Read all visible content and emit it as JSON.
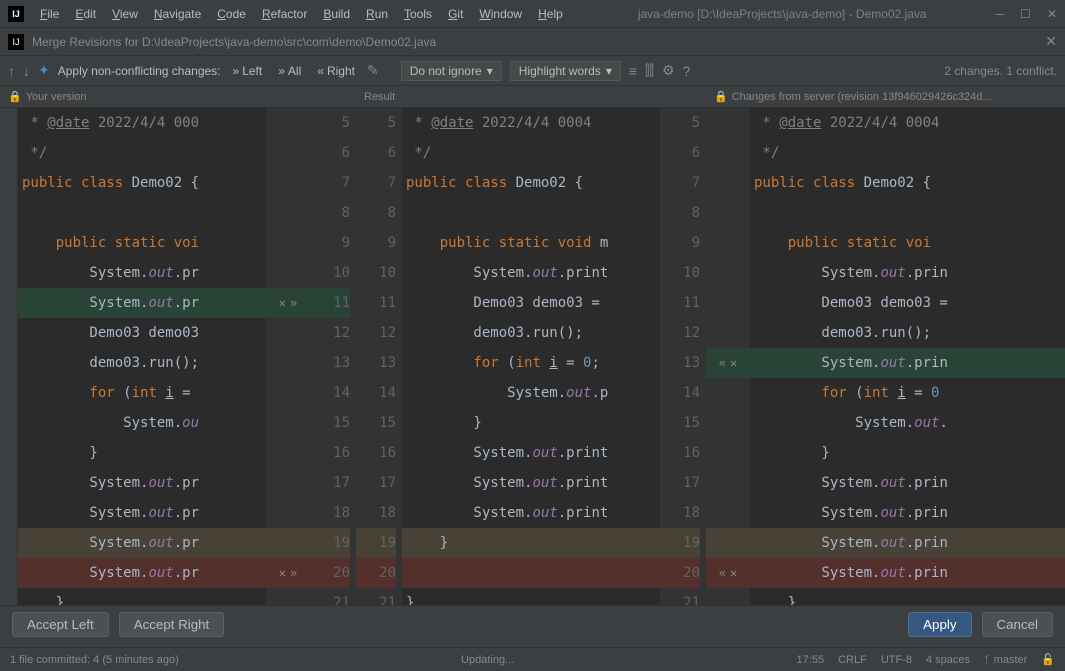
{
  "titlebar": {
    "menus": [
      "File",
      "Edit",
      "View",
      "Navigate",
      "Code",
      "Refactor",
      "Build",
      "Run",
      "Tools",
      "Git",
      "Window",
      "Help"
    ],
    "title": "java-demo [D:\\IdeaProjects\\java-demo] - Demo02.java"
  },
  "subtitle": {
    "label": "Merge Revisions for D:\\IdeaProjects\\java-demo\\src\\com\\demo\\Demo02.java"
  },
  "toolbar": {
    "apply_label": "Apply non-conflicting changes:",
    "left": "Left",
    "all": "All",
    "right": "Right",
    "ignore_dd": "Do not ignore",
    "highlight_dd": "Highlight words",
    "changes_info": "2 changes. 1 conflict."
  },
  "headers": {
    "left": "Your version",
    "mid": "Result",
    "right": "Changes from server (revision 13f946029426c324d..."
  },
  "panes": {
    "left": {
      "start": 5,
      "lines": [
        {
          "n": 5,
          "frag": [
            {
              "t": " * ",
              "c": "com"
            },
            {
              "t": "@date",
              "c": "com u"
            },
            {
              "t": " 2022/4/4 000",
              "c": "com"
            }
          ]
        },
        {
          "n": 6,
          "frag": [
            {
              "t": " */",
              "c": "com"
            }
          ]
        },
        {
          "n": 7,
          "frag": [
            {
              "t": "public ",
              "c": "kw"
            },
            {
              "t": "class ",
              "c": "kw"
            },
            {
              "t": "Demo02 ",
              "c": "typ"
            },
            {
              "t": "{",
              "c": "typ"
            }
          ]
        },
        {
          "n": 8,
          "frag": []
        },
        {
          "n": 9,
          "frag": [
            {
              "t": "    public ",
              "c": "kw"
            },
            {
              "t": "static ",
              "c": "kw"
            },
            {
              "t": "voi",
              "c": "kw"
            }
          ]
        },
        {
          "n": 10,
          "frag": [
            {
              "t": "        System.",
              "c": "typ"
            },
            {
              "t": "out",
              "c": "fld"
            },
            {
              "t": ".pr",
              "c": "typ"
            }
          ]
        },
        {
          "n": 11,
          "frag": [
            {
              "t": "        System.",
              "c": "typ"
            },
            {
              "t": "out",
              "c": "fld"
            },
            {
              "t": ".pr",
              "c": "typ"
            }
          ],
          "cls": "hl-green",
          "ops": [
            "x",
            "rr"
          ]
        },
        {
          "n": 12,
          "frag": [
            {
              "t": "        Demo03 demo03",
              "c": "typ"
            }
          ]
        },
        {
          "n": 13,
          "frag": [
            {
              "t": "        demo03.run();",
              "c": "typ"
            }
          ]
        },
        {
          "n": 14,
          "frag": [
            {
              "t": "        for ",
              "c": "kw"
            },
            {
              "t": "(",
              "c": "typ"
            },
            {
              "t": "int ",
              "c": "kw"
            },
            {
              "t": "i",
              "c": "typ u"
            },
            {
              "t": " = ",
              "c": "typ"
            }
          ]
        },
        {
          "n": 15,
          "frag": [
            {
              "t": "            System.",
              "c": "typ"
            },
            {
              "t": "ou",
              "c": "fld"
            }
          ]
        },
        {
          "n": 16,
          "frag": [
            {
              "t": "        }",
              "c": "typ"
            }
          ]
        },
        {
          "n": 17,
          "frag": [
            {
              "t": "        System.",
              "c": "typ"
            },
            {
              "t": "out",
              "c": "fld"
            },
            {
              "t": ".pr",
              "c": "typ"
            }
          ]
        },
        {
          "n": 18,
          "frag": [
            {
              "t": "        System.",
              "c": "typ"
            },
            {
              "t": "out",
              "c": "fld"
            },
            {
              "t": ".pr",
              "c": "typ"
            }
          ]
        },
        {
          "n": 19,
          "frag": [
            {
              "t": "        System.",
              "c": "typ"
            },
            {
              "t": "out",
              "c": "fld"
            },
            {
              "t": ".pr",
              "c": "typ"
            }
          ],
          "cls": "hl-red"
        },
        {
          "n": 20,
          "frag": [
            {
              "t": "        System.",
              "c": "typ"
            },
            {
              "t": "out",
              "c": "fld"
            },
            {
              "t": ".pr",
              "c": "typ"
            }
          ],
          "cls": "hl-dark-red",
          "ops": [
            "x",
            "rr"
          ]
        },
        {
          "n": 21,
          "frag": [
            {
              "t": "    }",
              "c": "typ"
            }
          ]
        }
      ]
    },
    "mid": {
      "lines": [
        {
          "n": 5,
          "frag": [
            {
              "t": " * ",
              "c": "com"
            },
            {
              "t": "@date",
              "c": "com u"
            },
            {
              "t": " 2022/4/4 0004",
              "c": "com"
            }
          ]
        },
        {
          "n": 6,
          "frag": [
            {
              "t": " */",
              "c": "com"
            }
          ]
        },
        {
          "n": 7,
          "frag": [
            {
              "t": "public ",
              "c": "kw"
            },
            {
              "t": "class ",
              "c": "kw"
            },
            {
              "t": "Demo02 ",
              "c": "typ"
            },
            {
              "t": "{",
              "c": "typ"
            }
          ]
        },
        {
          "n": 8,
          "frag": []
        },
        {
          "n": 9,
          "frag": [
            {
              "t": "    public ",
              "c": "kw"
            },
            {
              "t": "static ",
              "c": "kw"
            },
            {
              "t": "void ",
              "c": "kw"
            },
            {
              "t": "m",
              "c": "typ"
            }
          ]
        },
        {
          "n": 10,
          "frag": [
            {
              "t": "        System.",
              "c": "typ"
            },
            {
              "t": "out",
              "c": "fld"
            },
            {
              "t": ".print",
              "c": "typ"
            }
          ]
        },
        {
          "n": 11,
          "frag": [
            {
              "t": "        Demo03 demo03 =",
              "c": "typ"
            }
          ]
        },
        {
          "n": 12,
          "frag": [
            {
              "t": "        demo03.run();",
              "c": "typ"
            }
          ]
        },
        {
          "n": 13,
          "frag": [
            {
              "t": "        for ",
              "c": "kw"
            },
            {
              "t": "(",
              "c": "typ"
            },
            {
              "t": "int ",
              "c": "kw"
            },
            {
              "t": "i",
              "c": "typ u"
            },
            {
              "t": " = ",
              "c": "typ"
            },
            {
              "t": "0",
              "c": "num"
            },
            {
              "t": ";",
              "c": "typ"
            }
          ]
        },
        {
          "n": 14,
          "frag": [
            {
              "t": "            System.",
              "c": "typ"
            },
            {
              "t": "out",
              "c": "fld"
            },
            {
              "t": ".p",
              "c": "typ"
            }
          ]
        },
        {
          "n": 15,
          "frag": [
            {
              "t": "        }",
              "c": "typ"
            }
          ],
          "cls": "hl-changed-lite"
        },
        {
          "n": 16,
          "frag": [
            {
              "t": "        System.",
              "c": "typ"
            },
            {
              "t": "out",
              "c": "fld"
            },
            {
              "t": ".print",
              "c": "typ"
            }
          ]
        },
        {
          "n": 17,
          "frag": [
            {
              "t": "        System.",
              "c": "typ"
            },
            {
              "t": "out",
              "c": "fld"
            },
            {
              "t": ".print",
              "c": "typ"
            }
          ]
        },
        {
          "n": 18,
          "frag": [
            {
              "t": "        System.",
              "c": "typ"
            },
            {
              "t": "out",
              "c": "fld"
            },
            {
              "t": ".print",
              "c": "typ"
            }
          ]
        },
        {
          "n": 19,
          "frag": [
            {
              "t": "    }",
              "c": "typ"
            }
          ],
          "cls": "hl-red"
        },
        {
          "n": 20,
          "frag": [],
          "cls": "hl-dark-red"
        },
        {
          "n": 21,
          "frag": [
            {
              "t": "}",
              "c": "typ"
            }
          ]
        }
      ]
    },
    "right": {
      "lines": [
        {
          "n": 5,
          "frag": [
            {
              "t": " * ",
              "c": "com"
            },
            {
              "t": "@date",
              "c": "com u"
            },
            {
              "t": " 2022/4/4 0004",
              "c": "com"
            }
          ]
        },
        {
          "n": 6,
          "frag": [
            {
              "t": " */",
              "c": "com"
            }
          ]
        },
        {
          "n": 7,
          "frag": [
            {
              "t": "public ",
              "c": "kw"
            },
            {
              "t": "class ",
              "c": "kw"
            },
            {
              "t": "Demo02 ",
              "c": "typ"
            },
            {
              "t": "{",
              "c": "typ"
            }
          ]
        },
        {
          "n": 8,
          "frag": []
        },
        {
          "n": 9,
          "frag": [
            {
              "t": "    public ",
              "c": "kw"
            },
            {
              "t": "static ",
              "c": "kw"
            },
            {
              "t": "voi",
              "c": "kw"
            }
          ]
        },
        {
          "n": 10,
          "frag": [
            {
              "t": "        System.",
              "c": "typ"
            },
            {
              "t": "out",
              "c": "fld"
            },
            {
              "t": ".prin",
              "c": "typ"
            }
          ]
        },
        {
          "n": 11,
          "frag": [
            {
              "t": "        Demo03 demo03 =",
              "c": "typ"
            }
          ]
        },
        {
          "n": 12,
          "frag": [
            {
              "t": "        demo03.run();",
              "c": "typ"
            }
          ]
        },
        {
          "n": 13,
          "frag": [
            {
              "t": "        System.",
              "c": "typ"
            },
            {
              "t": "out",
              "c": "fld"
            },
            {
              "t": ".prin",
              "c": "typ"
            }
          ],
          "cls": "hl-green",
          "opsL": [
            "ll",
            "x"
          ]
        },
        {
          "n": 14,
          "frag": [
            {
              "t": "        for ",
              "c": "kw"
            },
            {
              "t": "(",
              "c": "typ"
            },
            {
              "t": "int ",
              "c": "kw"
            },
            {
              "t": "i",
              "c": "typ u"
            },
            {
              "t": " = ",
              "c": "typ"
            },
            {
              "t": "0",
              "c": "num"
            }
          ]
        },
        {
          "n": 15,
          "frag": [
            {
              "t": "            System.",
              "c": "typ"
            },
            {
              "t": "out",
              "c": "fld"
            },
            {
              "t": ".",
              "c": "typ"
            }
          ]
        },
        {
          "n": 16,
          "frag": [
            {
              "t": "        }",
              "c": "typ"
            }
          ]
        },
        {
          "n": 17,
          "frag": [
            {
              "t": "        System.",
              "c": "typ"
            },
            {
              "t": "out",
              "c": "fld"
            },
            {
              "t": ".prin",
              "c": "typ"
            }
          ]
        },
        {
          "n": 18,
          "frag": [
            {
              "t": "        System.",
              "c": "typ"
            },
            {
              "t": "out",
              "c": "fld"
            },
            {
              "t": ".prin",
              "c": "typ"
            }
          ]
        },
        {
          "n": 19,
          "frag": [
            {
              "t": "        System.",
              "c": "typ"
            },
            {
              "t": "out",
              "c": "fld"
            },
            {
              "t": ".prin",
              "c": "typ"
            }
          ],
          "cls": "hl-red"
        },
        {
          "n": 20,
          "frag": [
            {
              "t": "        System.",
              "c": "typ"
            },
            {
              "t": "out",
              "c": "fld"
            },
            {
              "t": ".prin",
              "c": "typ"
            }
          ],
          "cls": "hl-dark-red",
          "opsL": [
            "ll",
            "x"
          ]
        },
        {
          "n": 21,
          "frag": [
            {
              "t": "    }",
              "c": "typ"
            }
          ]
        }
      ]
    }
  },
  "buttons": {
    "accept_left": "Accept Left",
    "accept_right": "Accept Right",
    "apply": "Apply",
    "cancel": "Cancel"
  },
  "status": {
    "left": "1 file committed: 4 (5 minutes ago)",
    "mid": "Updating...",
    "pos": "17:55",
    "sep": "CRLF",
    "enc": "UTF-8",
    "indent": "4 spaces",
    "branch": "master"
  }
}
